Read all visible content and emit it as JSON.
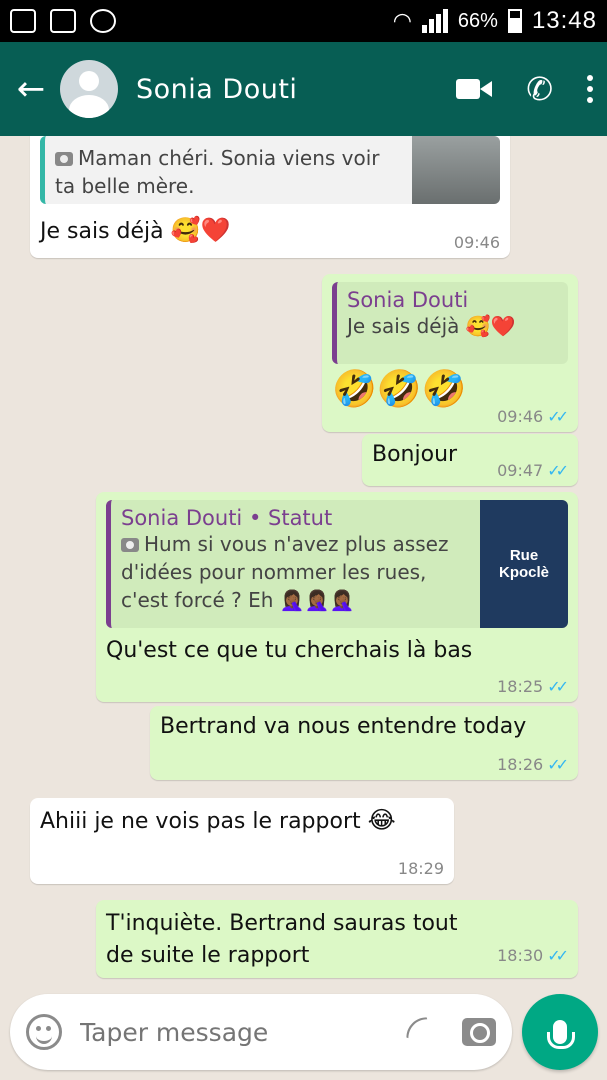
{
  "status_bar": {
    "battery": "66%",
    "time": "13:48"
  },
  "header": {
    "contact_name": "Sonia Douti",
    "icons": [
      "back-arrow-icon",
      "avatar",
      "video-call-icon",
      "phone-icon",
      "more-vert-icon"
    ]
  },
  "messages": [
    {
      "direction": "in",
      "quote_text": "Maman chéri. Sonia viens voir ta belle mère.",
      "text": "Je sais déjà",
      "emoji": "🥰❤️",
      "time": "09:46"
    },
    {
      "direction": "out",
      "quote_author": "Sonia Douti",
      "quote_text": "Je sais déjà",
      "quote_emoji": "🥰❤️",
      "emoji": "🤣🤣🤣",
      "time": "09:46"
    },
    {
      "direction": "out",
      "text": "Bonjour",
      "time": "09:47"
    },
    {
      "direction": "out",
      "quote_author": "Sonia Douti • Statut",
      "quote_text": "Hum si vous n'avez plus assez d'idées pour nommer les rues, c'est forcé ? Eh",
      "quote_emoji": "🤦🏾‍♀️🤦🏾‍♀️🤦🏾‍♀️",
      "thumb_line1": "Rue",
      "thumb_line2": "Kpoclè",
      "text": "Qu'est ce que tu cherchais là bas",
      "time": "18:25"
    },
    {
      "direction": "out",
      "text": "Bertrand va nous entendre today",
      "time": "18:26"
    },
    {
      "direction": "in",
      "text": "Ahiii je ne vois pas le rapport",
      "emoji": "😂",
      "time": "18:29"
    },
    {
      "direction": "out",
      "text": "T'inquiète. Bertrand sauras tout de suite le rapport",
      "time": "18:30"
    }
  ],
  "input": {
    "placeholder": "Taper message"
  },
  "colors": {
    "app_bar": "#075e54",
    "outgoing": "#dcf8c6",
    "incoming": "#ffffff",
    "background": "#ece5dd",
    "ticks": "#34b7f1",
    "mic_button": "#00a884"
  }
}
